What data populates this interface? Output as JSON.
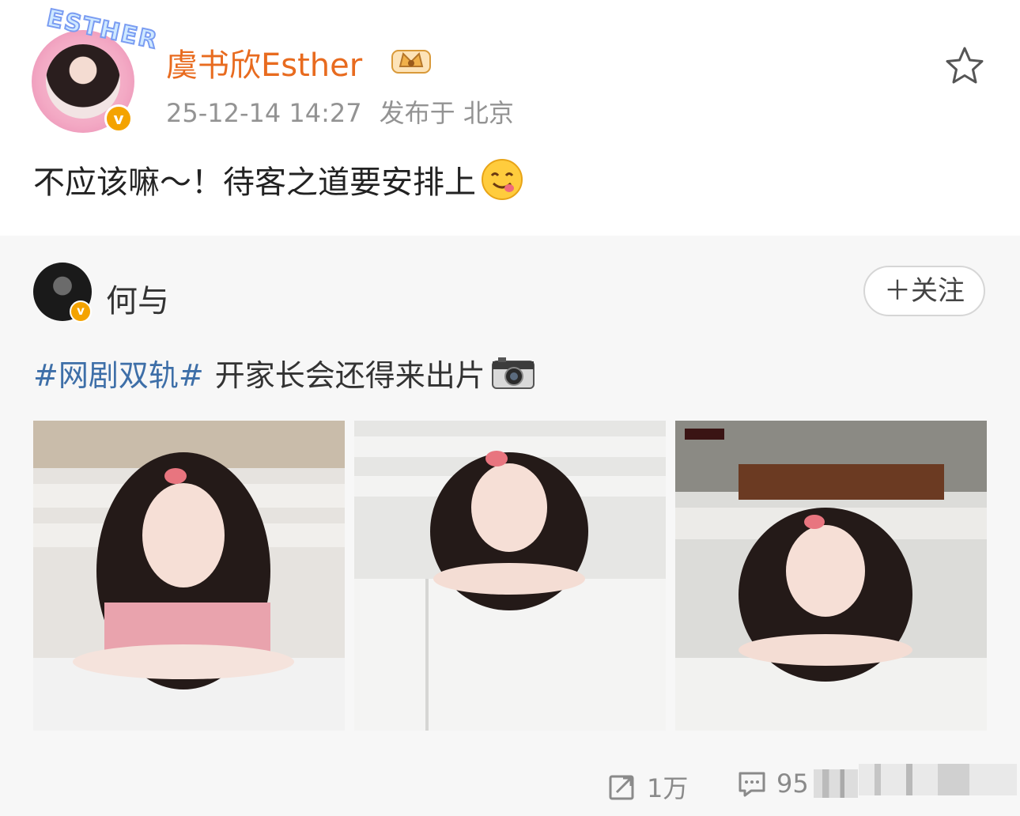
{
  "post": {
    "avatar_text": "ESTHER",
    "username": "虞书欣Esther",
    "timestamp": "25-12-14 14:27",
    "source": "发布于 北京",
    "text": "不应该嘛～！待客之道要安排上",
    "icons": {
      "favorite": "star-outline-icon",
      "emoji": "yum-face-emoji",
      "badge": "crown-member-icon",
      "verified": "verified-v-icon"
    }
  },
  "repost": {
    "username": "何与",
    "follow_label": "＋关注",
    "hashtag": "#网剧双轨#",
    "text": "开家长会还得来出片",
    "icons": {
      "camera": "camera-emoji"
    }
  },
  "actions": {
    "repost_count": "1万",
    "comment_count": "95"
  },
  "colors": {
    "username": "#e86b1f",
    "hashtag": "#3e6fa8",
    "repost_bg": "#f7f7f7",
    "meta": "#939393"
  }
}
